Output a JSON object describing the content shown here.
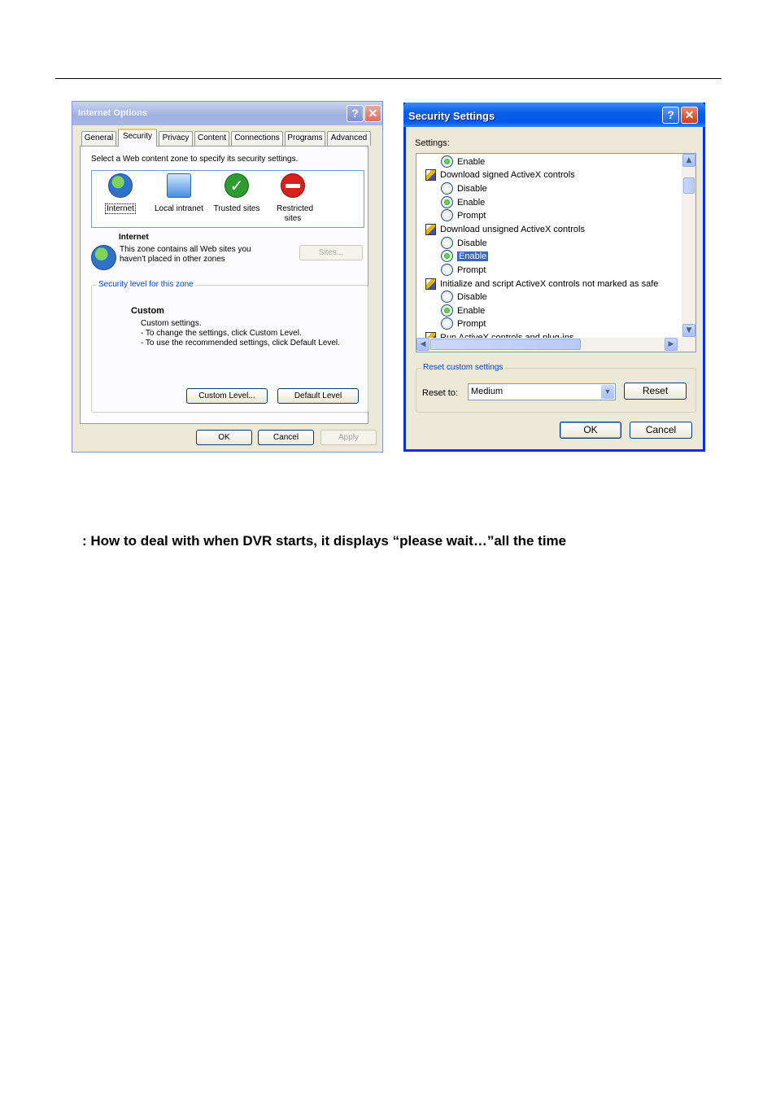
{
  "internet_options": {
    "title": "Internet Options",
    "help_glyph": "?",
    "close_glyph": "✕",
    "tabs": [
      "General",
      "Security",
      "Privacy",
      "Content",
      "Connections",
      "Programs",
      "Advanced"
    ],
    "active_tab": "Security",
    "zone_prompt": "Select a Web content zone to specify its security settings.",
    "zones": [
      {
        "label": "Internet",
        "icon": "globe-icon"
      },
      {
        "label": "Local intranet",
        "icon": "monitor-icon"
      },
      {
        "label": "Trusted sites",
        "icon": "checkmark-icon"
      },
      {
        "label": "Restricted sites",
        "icon": "no-entry-icon"
      }
    ],
    "selected_zone": "Internet",
    "zone_name": "Internet",
    "zone_description": "This zone contains all Web sites you\nhaven't placed in other zones",
    "sites_button": "Sites...",
    "security_level_legend": "Security level for this zone",
    "level_title": "Custom",
    "level_lines": [
      "Custom settings.",
      "- To change the settings, click Custom Level.",
      "- To use the recommended settings, click Default Level."
    ],
    "custom_level_button": "Custom Level...",
    "default_level_button": "Default Level",
    "ok_button": "OK",
    "cancel_button": "Cancel",
    "apply_button": "Apply"
  },
  "security_settings": {
    "title": "Security Settings",
    "help_glyph": "?",
    "close_glyph": "✕",
    "settings_label": "Settings:",
    "rows": [
      {
        "kind": "option",
        "label": "Enable",
        "checked": true
      },
      {
        "kind": "setting",
        "label": "Download signed ActiveX controls"
      },
      {
        "kind": "option",
        "label": "Disable",
        "checked": false
      },
      {
        "kind": "option",
        "label": "Enable",
        "checked": true
      },
      {
        "kind": "option",
        "label": "Prompt",
        "checked": false
      },
      {
        "kind": "setting",
        "label": "Download unsigned ActiveX controls"
      },
      {
        "kind": "option",
        "label": "Disable",
        "checked": false
      },
      {
        "kind": "option",
        "label": "Enable",
        "checked": true,
        "selected": true
      },
      {
        "kind": "option",
        "label": "Prompt",
        "checked": false
      },
      {
        "kind": "setting",
        "label": "Initialize and script ActiveX controls not marked as safe"
      },
      {
        "kind": "option",
        "label": "Disable",
        "checked": false
      },
      {
        "kind": "option",
        "label": "Enable",
        "checked": true
      },
      {
        "kind": "option",
        "label": "Prompt",
        "checked": false
      },
      {
        "kind": "setting",
        "label": "Run ActiveX controls and plug-ins"
      }
    ],
    "reset_legend": "Reset custom settings",
    "reset_to_label": "Reset to:",
    "reset_to_value": "Medium",
    "reset_button": "Reset",
    "ok_button": "OK",
    "cancel_button": "Cancel",
    "scroll_up_glyph": "▲",
    "scroll_down_glyph": "▼",
    "scroll_left_glyph": "◀",
    "scroll_right_glyph": "▶",
    "dropdown_glyph": "▼"
  },
  "faq_question": ": How to deal with when DVR starts, it displays “please wait…”all the time"
}
